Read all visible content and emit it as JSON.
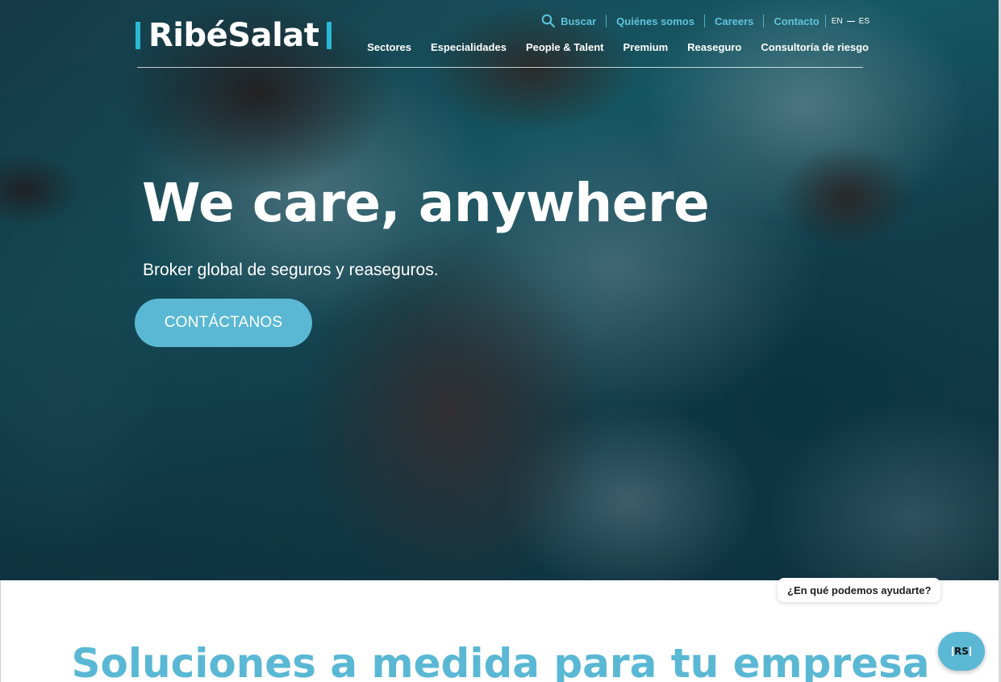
{
  "brand": {
    "logo_text": "RibéSalat",
    "accent_color": "#29b9d4",
    "button_color": "#5ab8d4"
  },
  "topnav": {
    "search_icon": "search-icon",
    "search_label": "Buscar",
    "items": [
      "Quiénes somos",
      "Careers",
      "Contacto"
    ],
    "lang_en": "EN",
    "lang_es": "ES"
  },
  "mainnav": {
    "items": [
      "Sectores",
      "Especialidades",
      "People & Talent",
      "Premium",
      "Reaseguro",
      "Consultoría de riesgo"
    ]
  },
  "hero": {
    "title": "We care, anywhere",
    "subtitle": "Broker global de seguros y reaseguros.",
    "cta_label": "CONTÁCTANOS"
  },
  "section": {
    "title": "Soluciones a medida para tu empresa"
  },
  "chat": {
    "prompt": "¿En qué podemos ayudarte?",
    "launcher_text": "RS"
  }
}
